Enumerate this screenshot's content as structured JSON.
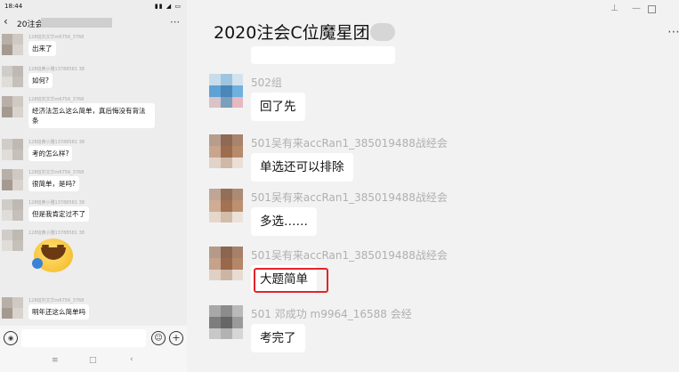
{
  "phone": {
    "status_time": "18:44",
    "title": "20注会",
    "messages": [
      {
        "name": "128班刘文华m6756_3768",
        "text": "出来了"
      },
      {
        "name": "128班黄小雅13788581 38",
        "text": "如何?"
      },
      {
        "name": "128班刘文华m6756_3768",
        "text": "经济法怎么这么简单，真后悔没有背法条"
      },
      {
        "name": "128班黄小雅13788581 38",
        "text": "考的怎么样?"
      },
      {
        "name": "128班刘文华m6756_3768",
        "text": "很简单，是吗?"
      },
      {
        "name": "128班黄小雅13788581 38",
        "text": "但是我肯定过不了"
      },
      {
        "name": "128班黄小雅13788581 38",
        "text": ""
      },
      {
        "name": "128班刘文华m6756_3768",
        "text": "明年还这么简单吗"
      }
    ]
  },
  "desktop": {
    "group_title": "2020注会C位魔星团",
    "messages": [
      {
        "name": "502组",
        "text": "回了先"
      },
      {
        "name": "501吴有来accRan1_385019488战经会",
        "text": "单选还可以排除"
      },
      {
        "name": "501吴有来accRan1_385019488战经会",
        "text": "多选……"
      },
      {
        "name": "501吴有来accRan1_385019488战经会",
        "text": "大题简单"
      },
      {
        "name": "501 邓成功 m9964_16588 会经",
        "text": "考完了"
      }
    ]
  },
  "colors": {
    "highlight": "#e0242b",
    "bubble": "#ffffff",
    "chat_background": "#f2f2f2"
  }
}
